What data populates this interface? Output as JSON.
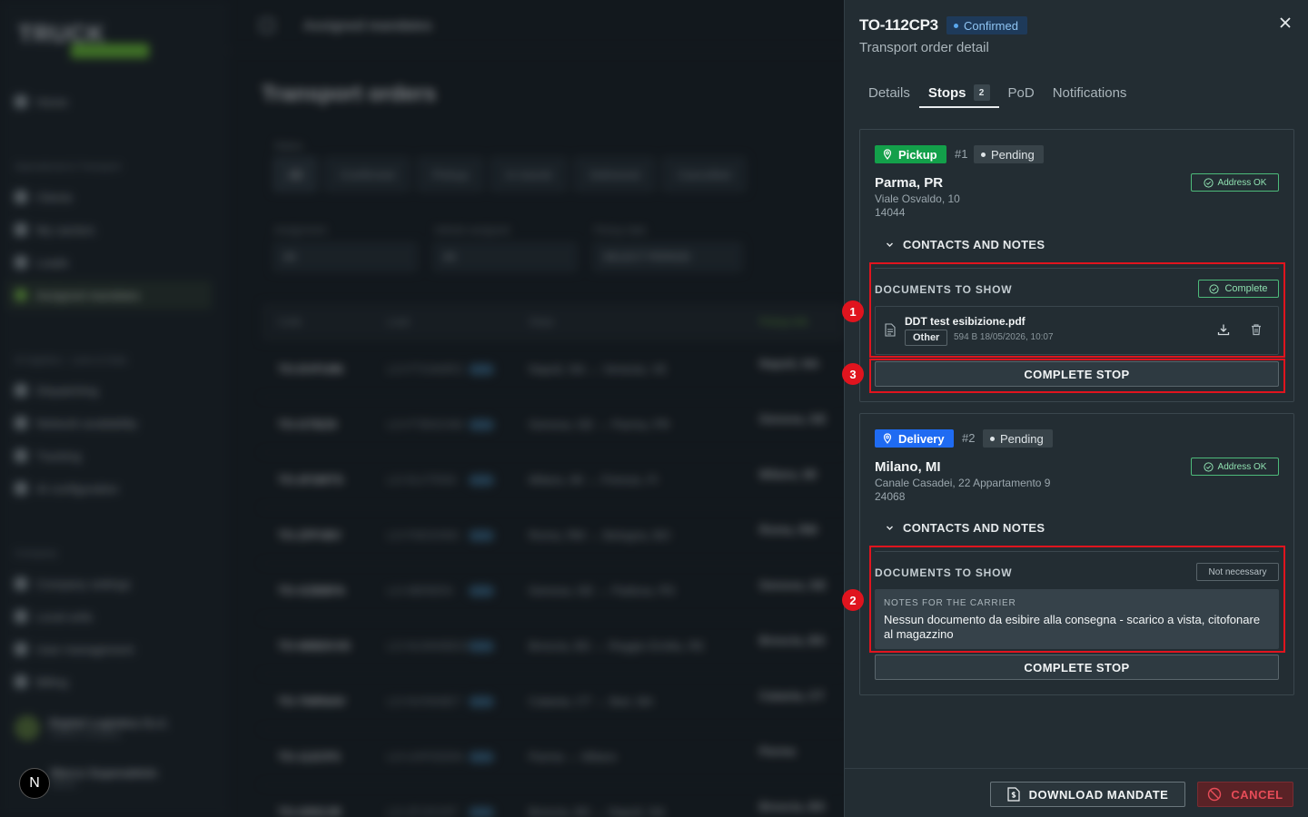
{
  "background": {
    "logo": "TRUCK",
    "topbar_title": "Assigned mandates",
    "page_title": "Transport orders",
    "nav": {
      "home": "Home",
      "section_ops": "Operational & Transport",
      "clients": "Clients",
      "carriers": "My carriers",
      "loads": "Loads",
      "assigned": "Assigned mandates",
      "section_ai": "AI logistics - Lane & Data",
      "dispatching": "Dispatching",
      "network": "Network availability",
      "tracking": "Tracking",
      "ai_config": "AI configuration",
      "section_company": "Company",
      "company_settings": "Company settings",
      "local_units": "Local units",
      "user_mgmt": "User management",
      "billing": "Billing",
      "org_name": "Digital Logistics S.r.l.",
      "org_sub": "Carriers company",
      "user_name": "Marco Superadmin",
      "user_sub": "Admin"
    },
    "filters": {
      "status_label": "Status",
      "chips": [
        "All",
        "Confirmed",
        "Pickup",
        "In transit",
        "Delivered",
        "Cancelled"
      ],
      "assignment_label": "Assignment",
      "assignment_value": "All",
      "vehicle_label": "Vehicle assigned",
      "vehicle_value": "All",
      "pickup_label": "Pickup date",
      "pickup_value": "SELECT PERIOD"
    },
    "table": {
      "headers": [
        "Code",
        "Load",
        "Stops",
        "Pickup info"
      ],
      "rows": [
        {
          "code": "TO-DVFU86",
          "load": "LO-FTHAMR3",
          "route": "Napoli, NA → Venezia, VE",
          "pickup": "Napoli, NA"
        },
        {
          "code": "TO-GTBZ9",
          "load": "LO-FTBNO4M",
          "route": "Genova, GE → Parma, PR",
          "pickup": "Genova, GE"
        },
        {
          "code": "TO-2F2MTS",
          "load": "LO-5LVTR09",
          "route": "Milano, MI → Firenze, FI",
          "pickup": "Milano, MI"
        },
        {
          "code": "TO-ZPF48V",
          "load": "LO-FMOHNN",
          "route": "Roma, RM → Bologna, BO",
          "pickup": "Roma, RM"
        },
        {
          "code": "TO-XZBBFA",
          "load": "LO-9BRB5N",
          "route": "Genova, GE → Padova, PD",
          "pickup": "Genova, GE"
        },
        {
          "code": "TO-WBEKVD",
          "load": "LO-NUMWBDO",
          "route": "Brescia, BS → Reggio Emilia, RE",
          "pickup": "Brescia, BS"
        },
        {
          "code": "TO-7NRNAV",
          "load": "LO-NVNN9E7",
          "route": "Catania, CT → Bari, BA",
          "pickup": "Catania, CT"
        },
        {
          "code": "TO-112CP3",
          "load": "LO-UXP2DDN",
          "route": "Parma → Milano",
          "pickup": "Parma"
        },
        {
          "code": "TO-GRIZJR",
          "load": "LO-ZFJOV9T",
          "route": "Brescia, BS → Napoli, NA",
          "pickup": "Brescia, BS"
        }
      ]
    }
  },
  "drawer": {
    "code": "TO-112CP3",
    "status": "Confirmed",
    "subtitle": "Transport order detail",
    "tabs": [
      {
        "label": "Details"
      },
      {
        "label": "Stops",
        "count": "2"
      },
      {
        "label": "PoD"
      },
      {
        "label": "Notifications"
      }
    ],
    "stops": [
      {
        "type": "Pickup",
        "seq": "#1",
        "status": "Pending",
        "city": "Parma, PR",
        "street": "Viale Osvaldo, 10",
        "zip": "14044",
        "address_ok": "Address OK",
        "contacts": "CONTACTS AND NOTES",
        "docs_title": "DOCUMENTS TO SHOW",
        "docs_status": "Complete",
        "file_name": "DDT test esibizione.pdf",
        "file_tag": "Other",
        "file_meta": "594 B  18/05/2026, 10:07",
        "complete_label": "COMPLETE STOP",
        "type_color": "#13a04a"
      },
      {
        "type": "Delivery",
        "seq": "#2",
        "status": "Pending",
        "city": "Milano, MI",
        "street": "Canale Casadei, 22 Appartamento 9",
        "zip": "24068",
        "address_ok": "Address OK",
        "contacts": "CONTACTS AND NOTES",
        "docs_title": "DOCUMENTS TO SHOW",
        "docs_status": "Not necessary",
        "notes_title": "NOTES FOR THE CARRIER",
        "notes_text": "Nessun documento da esibire alla consegna - scarico a vista, citofonare al magazzino",
        "complete_label": "COMPLETE STOP",
        "type_color": "#1f6bf2"
      }
    ],
    "annotations": [
      "1",
      "2",
      "3"
    ],
    "footer": {
      "download": "DOWNLOAD MANDATE",
      "cancel": "CANCEL"
    }
  },
  "colors": {
    "highlight": "#e0141e",
    "accent_green": "#4dba7a",
    "confirmed_blue": "#5aa8ee"
  },
  "devtools_badge": "N"
}
